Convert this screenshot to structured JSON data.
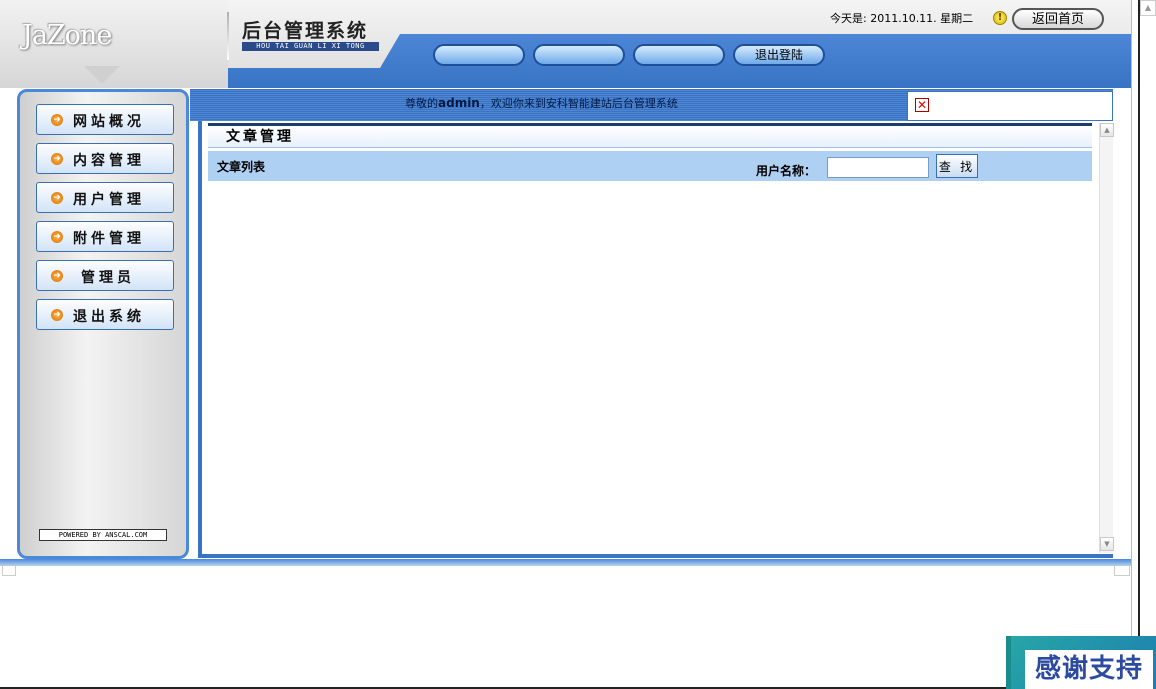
{
  "header": {
    "logo": "JaZone",
    "system_title": "后台管理系统",
    "system_pinyin": "HOU TAI GUAN LI XI TONG",
    "date_label": "今天是: 2011.10.11.  星期二",
    "warn_icon": "exclamation-icon",
    "home_button": "返回首页",
    "nav_buttons": [
      "",
      "",
      "",
      "退出登陆"
    ]
  },
  "sidebar": {
    "items": [
      {
        "label": "网站概况"
      },
      {
        "label": "内容管理"
      },
      {
        "label": "用户管理"
      },
      {
        "label": "附件管理"
      },
      {
        "label": "管理员"
      },
      {
        "label": "退出系统"
      }
    ],
    "powered": "POWERED BY ANSCAL.COM"
  },
  "welcome": {
    "prefix": "尊敬的",
    "user": "admin",
    "suffix": "，欢迎你来到安科智能建站后台管理系统"
  },
  "main": {
    "section_title": "文章管理",
    "list_label": "文章列表",
    "user_name_label": "用户名称：",
    "user_name_value": "",
    "find_button": "查 找"
  },
  "badge": {
    "text": "感谢支持"
  },
  "colors": {
    "accent_blue": "#3a72c4",
    "light_blue": "#aed0f2",
    "close_red": "#e00000"
  }
}
